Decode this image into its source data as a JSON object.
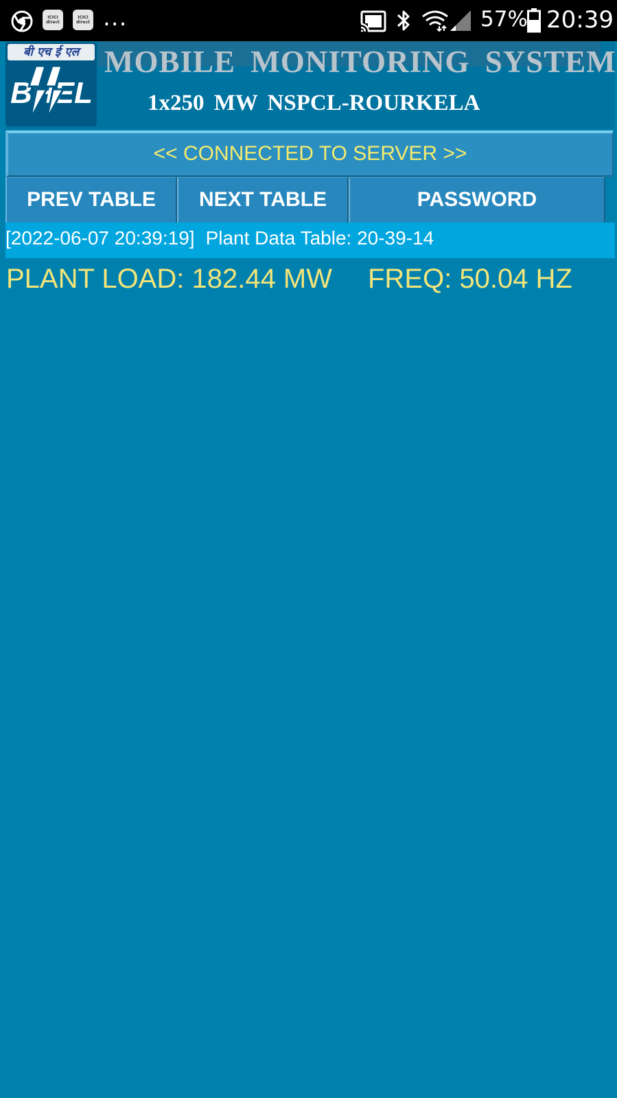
{
  "status_bar": {
    "notification_icons": [
      "chrome-icon",
      "icici-direct-icon",
      "icici-direct-icon"
    ],
    "notif_app_label": "ICICI direct",
    "more": "...",
    "battery": "57%",
    "time": "20:39"
  },
  "header": {
    "logo_hindi": "बी एच ई एल",
    "logo_text": "BHEL",
    "title": "MOBILE  MONITORING  SYSTEM",
    "subtitle": "1x250 MW  NSPCL-ROURKELA"
  },
  "connection": {
    "status": "<< CONNECTED TO SERVER >>"
  },
  "nav": {
    "prev": "PREV TABLE",
    "next": "NEXT TABLE",
    "password": "PASSWORD"
  },
  "info": {
    "timestamp": "[2022-06-07 20:39:19]",
    "table_label": "Plant Data Table: 20-39-14"
  },
  "plant": {
    "load": "PLANT LOAD: 182.44 MW",
    "freq": "FREQ: 50.04 HZ"
  },
  "colors": {
    "background": "#0080AD",
    "highlight_text": "#F3E57A",
    "info_bar": "#01A6DF"
  }
}
